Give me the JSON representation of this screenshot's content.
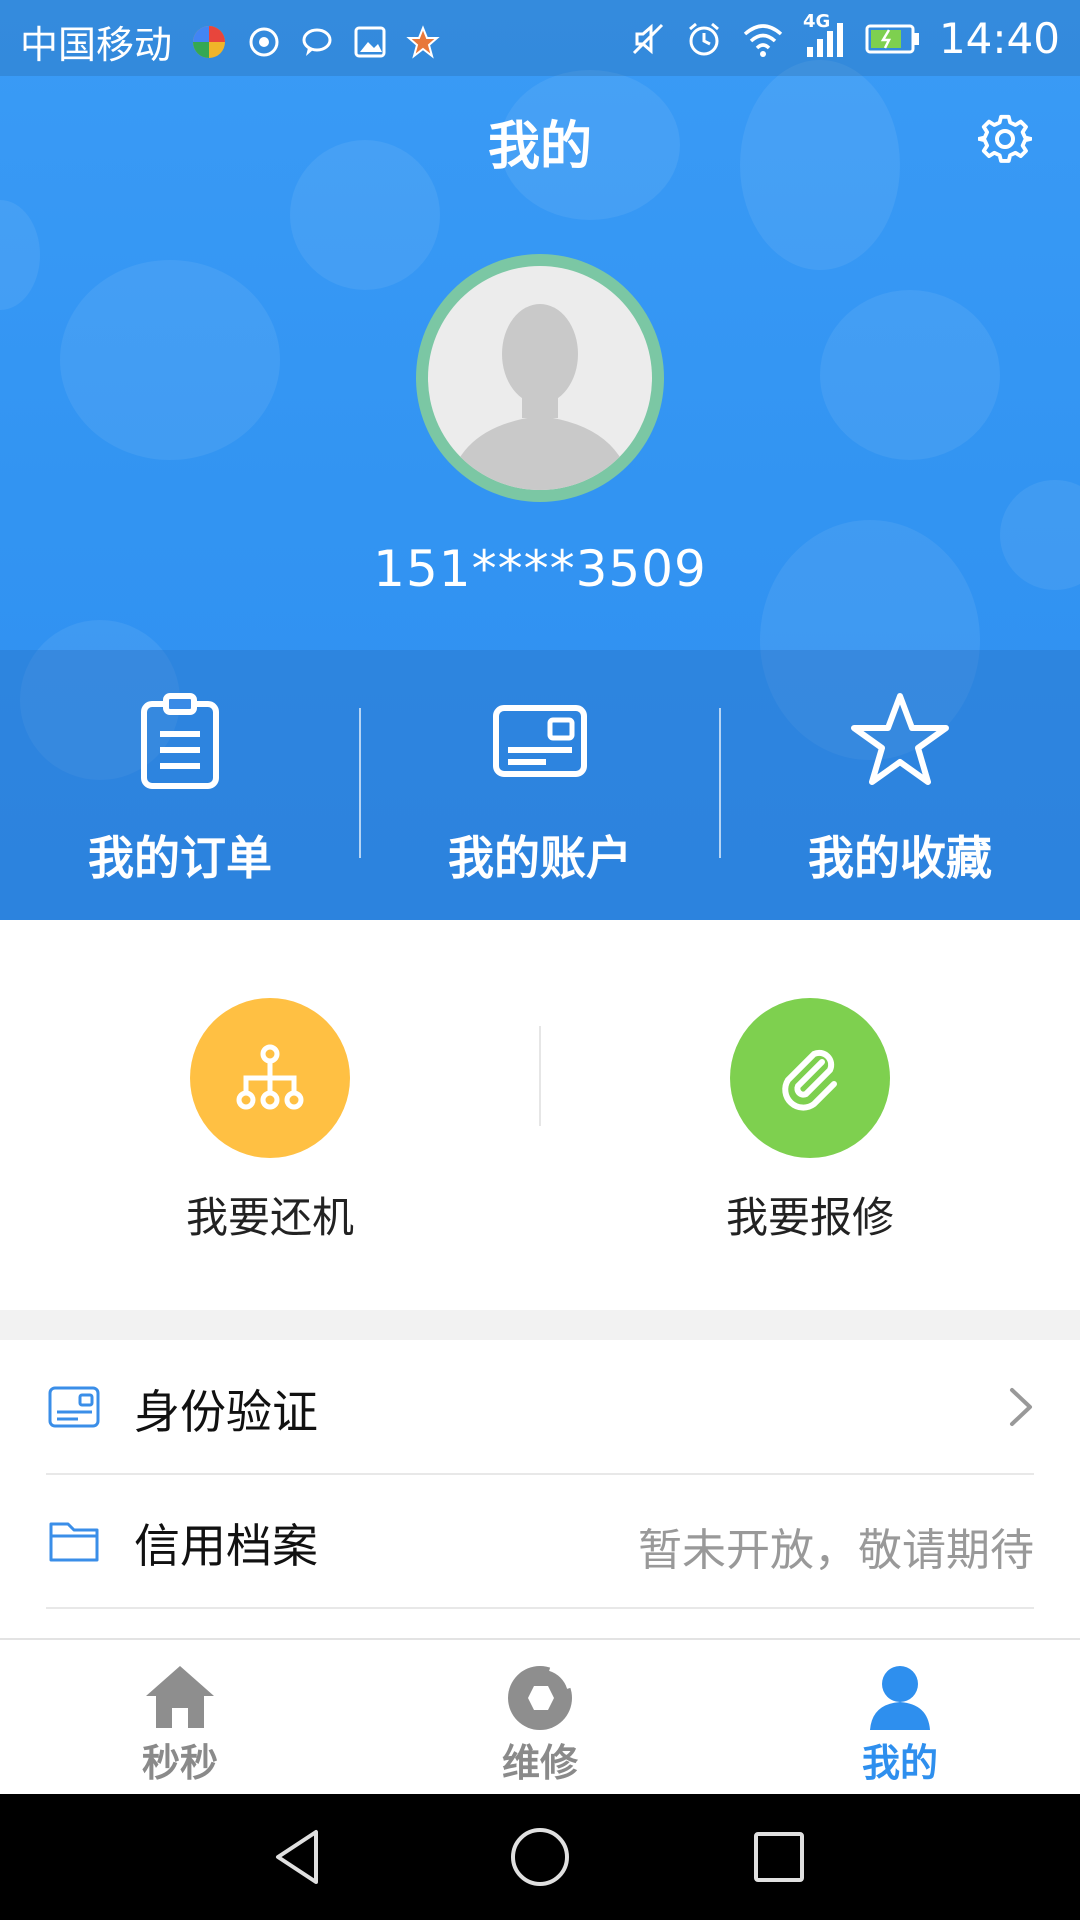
{
  "status_bar": {
    "carrier": "中国移动",
    "network": "4G",
    "time": "14:40"
  },
  "header": {
    "title": "我的",
    "settings_icon": "gear-icon",
    "avatar_icon": "user-silhouette-icon",
    "phone": "151****3509"
  },
  "quick_links": [
    {
      "label": "我的订单",
      "icon": "clipboard-icon"
    },
    {
      "label": "我的账户",
      "icon": "card-icon"
    },
    {
      "label": "我的收藏",
      "icon": "star-icon"
    }
  ],
  "actions": [
    {
      "label": "我要还机",
      "icon": "network-nodes-icon",
      "color": "#ffc043"
    },
    {
      "label": "我要报修",
      "icon": "paperclip-icon",
      "color": "#7ed04f"
    }
  ],
  "menu": [
    {
      "label": "身份验证",
      "icon": "id-card-icon",
      "right_text": "",
      "chevron": true
    },
    {
      "label": "信用档案",
      "icon": "folder-icon",
      "right_text": "暂未开放，敬请期待",
      "chevron": false
    }
  ],
  "tabs": [
    {
      "label": "秒秒",
      "icon": "home-icon",
      "active": false
    },
    {
      "label": "维修",
      "icon": "repair-icon",
      "active": false
    },
    {
      "label": "我的",
      "icon": "person-icon",
      "active": true
    }
  ],
  "colors": {
    "header_blue": "#3294f2",
    "accent_blue": "#2e8fee",
    "avatar_ring": "#7bc7a4",
    "action_yellow": "#ffc043",
    "action_green": "#7ed04f"
  }
}
